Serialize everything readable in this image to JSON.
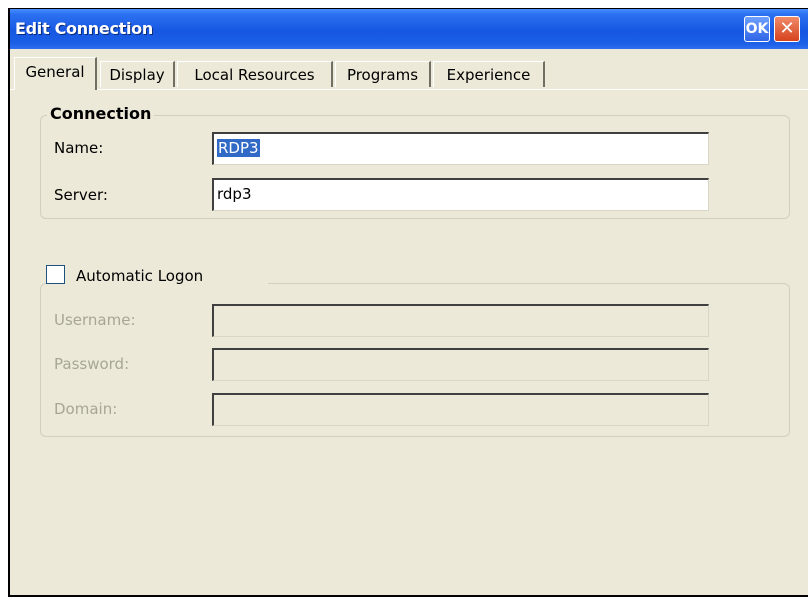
{
  "window": {
    "title": "Edit Connection",
    "ok_label": "OK",
    "close_label": "✕"
  },
  "tabs": [
    {
      "label": "General"
    },
    {
      "label": "Display"
    },
    {
      "label": "Local Resources"
    },
    {
      "label": "Programs"
    },
    {
      "label": "Experience"
    }
  ],
  "connection": {
    "legend": "Connection",
    "name_label": "Name:",
    "name_value": "RDP3",
    "server_label": "Server:",
    "server_value": "rdp3"
  },
  "logon": {
    "checkbox_label": "Automatic Logon",
    "checked": false,
    "username_label": "Username:",
    "username_value": "",
    "password_label": "Password:",
    "password_value": "",
    "domain_label": "Domain:",
    "domain_value": ""
  },
  "colors": {
    "titlebar": "#1657e2",
    "selection": "#3169c6",
    "dialog_bg": "#ece9d8",
    "disabled_text": "#a7a695"
  }
}
